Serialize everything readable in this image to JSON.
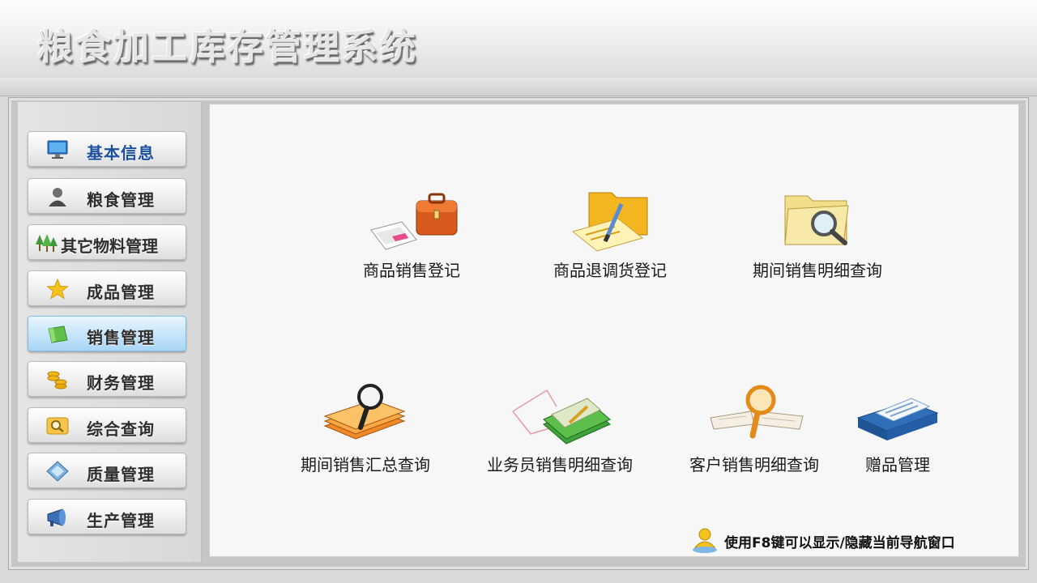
{
  "window": {
    "title": "粮食加工库存管理系统"
  },
  "sidebar": {
    "items": [
      {
        "label": "基本信息",
        "icon": "monitor-icon",
        "active": false
      },
      {
        "label": "粮食管理",
        "icon": "person-icon",
        "active": false
      },
      {
        "label": "其它物料管理",
        "icon": "trees-icon",
        "active": false
      },
      {
        "label": "成品管理",
        "icon": "star-icon",
        "active": false
      },
      {
        "label": "销售管理",
        "icon": "green-card-icon",
        "active": true
      },
      {
        "label": "财务管理",
        "icon": "coins-icon",
        "active": false
      },
      {
        "label": "综合查询",
        "icon": "search-box-icon",
        "active": false
      },
      {
        "label": "质量管理",
        "icon": "diamond-icon",
        "active": false
      },
      {
        "label": "生产管理",
        "icon": "horn-icon",
        "active": false
      }
    ]
  },
  "main": {
    "tiles": [
      {
        "label": "商品销售登记",
        "icon": "briefcase-icon"
      },
      {
        "label": "商品退调货登记",
        "icon": "folder-pen-icon"
      },
      {
        "label": "期间销售明细查询",
        "icon": "folder-magnifier-icon"
      },
      {
        "label": "期间销售汇总查询",
        "icon": "books-magnifier-icon"
      },
      {
        "label": "业务员销售明细查询",
        "icon": "green-books-icon"
      },
      {
        "label": "客户销售明细查询",
        "icon": "open-book-magnifier-icon"
      },
      {
        "label": "赠品管理",
        "icon": "blue-book-icon"
      }
    ]
  },
  "hint": {
    "text": "使用F8键可以显示/隐藏当前导航窗口",
    "icon": "user-hint-icon"
  },
  "colors": {
    "active_nav": "#a8d6f5",
    "first_nav_text": "#1c4f9c"
  }
}
